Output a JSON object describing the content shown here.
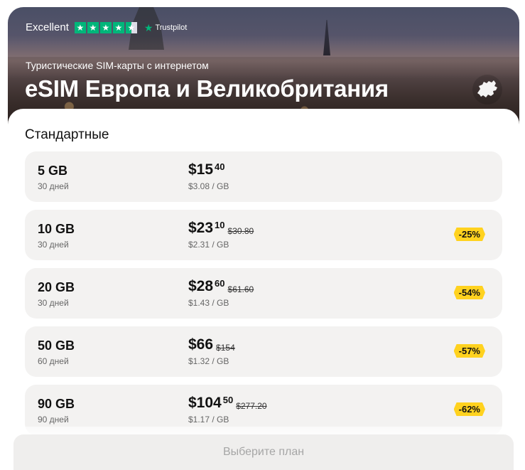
{
  "header": {
    "rating_label": "Excellent",
    "trustpilot_label": "Trustpilot",
    "stars_filled": 4.5,
    "stars_total": 5,
    "subtitle": "Туристические SIM-карты с интернетом",
    "title": "eSIM Европа и Великобритания",
    "region_icon": "europe-map-icon"
  },
  "section": {
    "title": "Стандартные"
  },
  "plans": [
    {
      "gb": "5 GB",
      "days": "30 дней",
      "price": "$15",
      "cents": "40",
      "old_price": "",
      "per_gb": "$3.08 / GB",
      "discount": ""
    },
    {
      "gb": "10 GB",
      "days": "30 дней",
      "price": "$23",
      "cents": "10",
      "old_price": "$30.80",
      "per_gb": "$2.31 / GB",
      "discount": "-25%"
    },
    {
      "gb": "20 GB",
      "days": "30 дней",
      "price": "$28",
      "cents": "60",
      "old_price": "$61.60",
      "per_gb": "$1.43 / GB",
      "discount": "-54%"
    },
    {
      "gb": "50 GB",
      "days": "60 дней",
      "price": "$66",
      "cents": "",
      "old_price": "$154",
      "per_gb": "$1.32 / GB",
      "discount": "-57%"
    },
    {
      "gb": "90 GB",
      "days": "90 дней",
      "price": "$104",
      "cents": "50",
      "old_price": "$277.20",
      "per_gb": "$1.17 / GB",
      "discount": "-62%"
    }
  ],
  "footer": {
    "button_label": "Выберите план"
  },
  "colors": {
    "trustpilot_green": "#00b67a",
    "discount_yellow": "#ffd21f",
    "card_bg": "#f3f2f1"
  }
}
